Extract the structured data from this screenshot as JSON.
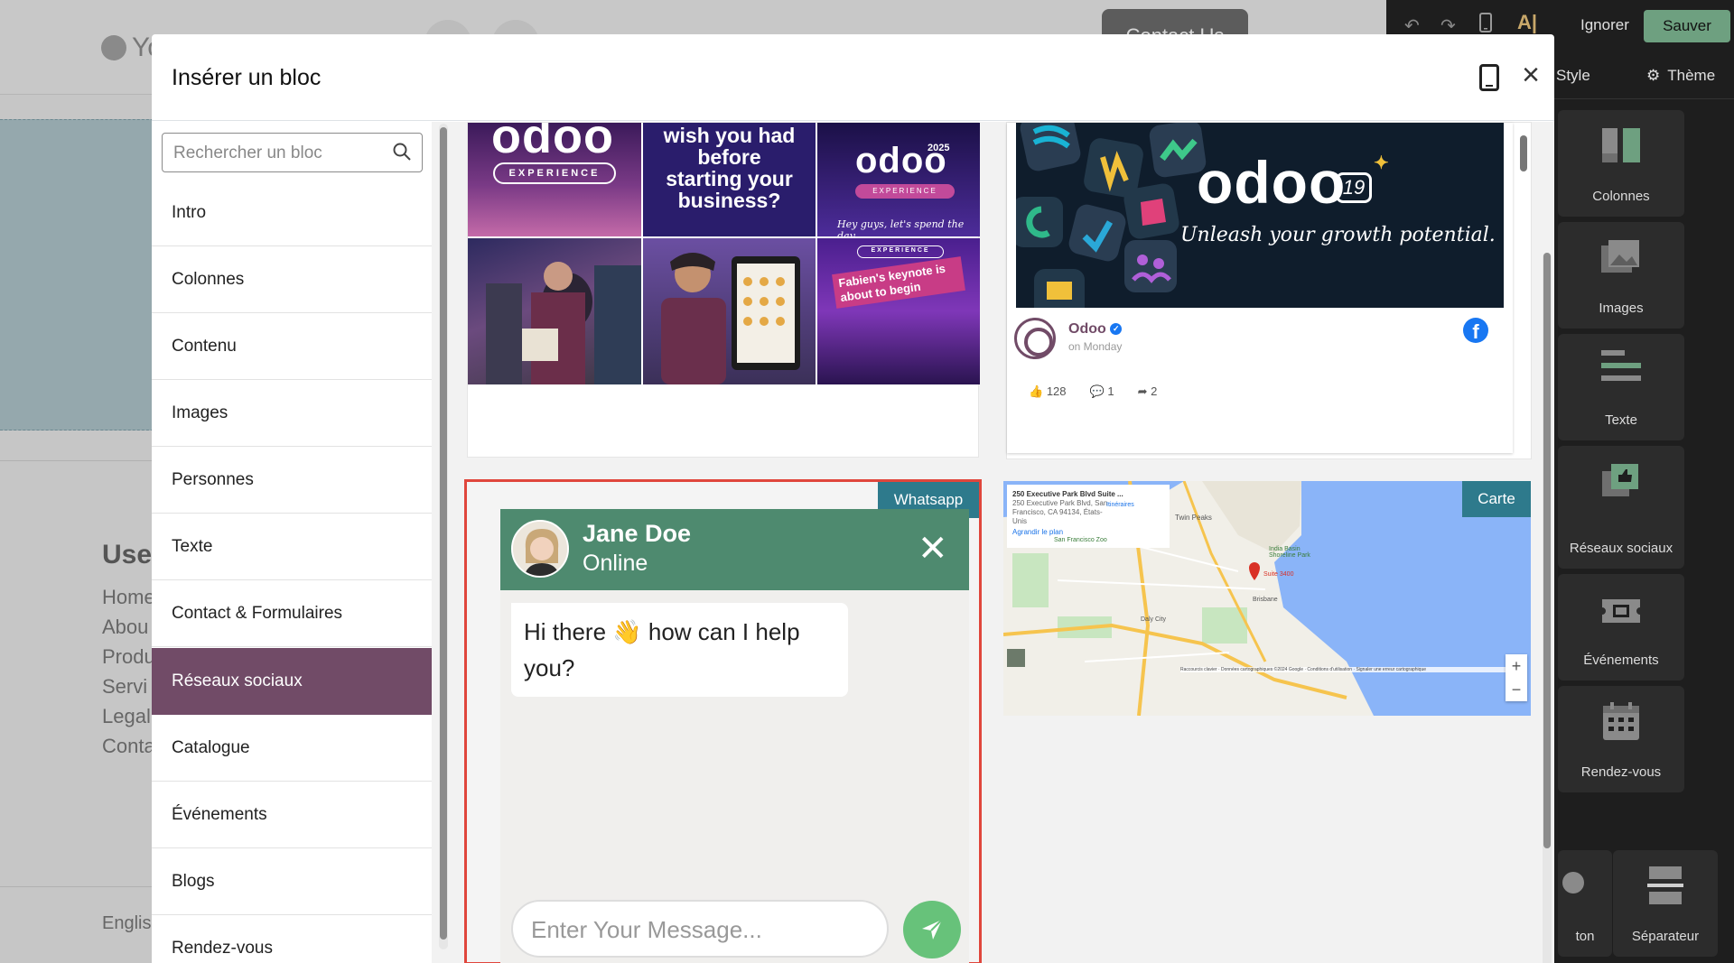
{
  "background": {
    "logo_text": "Yo",
    "contact_button": "Contact Us",
    "useful_heading": "Usef",
    "links": [
      "Home",
      "Abou",
      "Produ",
      "Servi",
      "Legal",
      "Conta"
    ],
    "language": "Englis"
  },
  "editor": {
    "ignore_label": "Ignorer",
    "save_label": "Sauver",
    "tabs": [
      "Style",
      "Thème"
    ],
    "blocks": [
      {
        "label": "Colonnes",
        "icon": "columns-icon"
      },
      {
        "label": "Images",
        "icon": "images-icon"
      },
      {
        "label": "Texte",
        "icon": "text-icon"
      },
      {
        "label": "Réseaux sociaux",
        "icon": "social-icon"
      },
      {
        "label": "Événements",
        "icon": "ticket-icon"
      },
      {
        "label": "Rendez-vous",
        "icon": "calendar-icon"
      },
      {
        "label": "ton",
        "icon": "button-icon"
      },
      {
        "label": "Séparateur",
        "icon": "separator-icon"
      }
    ],
    "colors": {
      "save": "#6ea080",
      "bg": "#1e1e1e"
    }
  },
  "modal": {
    "title": "Insérer un bloc",
    "search_placeholder": "Rechercher un bloc",
    "categories": [
      "Intro",
      "Colonnes",
      "Contenu",
      "Images",
      "Personnes",
      "Texte",
      "Contact & Formulaires",
      "Réseaux sociaux",
      "Catalogue",
      "Événements",
      "Blogs",
      "Rendez-vous"
    ],
    "active_category": "Réseaux sociaux",
    "accent_color": "#714b67"
  },
  "instagram": {
    "tile1_logo": "odoo",
    "tile1_badge": "EXPERIENCE",
    "tile2_text": "wish you had before starting your business?",
    "tile3_year": "2025",
    "tile3_logo": "odoo",
    "tile3_badge": "EXPERIENCE",
    "tile3_caption": "Hey guys, let's spend the day",
    "tile6_badge": "EXPERIENCE",
    "tile6_caption": "Fabien's keynote is about to begin"
  },
  "facebook": {
    "banner_logo": "odoo",
    "banner_version": "19",
    "banner_tagline": "Unleash your growth potential.",
    "page_name": "Odoo",
    "post_time": "on Monday",
    "likes": "128",
    "comments": "1",
    "shares": "2"
  },
  "whatsapp": {
    "badge": "Whatsapp",
    "name": "Jane Doe",
    "status": "Online",
    "message": "Hi there 👋 how can I help you?",
    "input_placeholder": "Enter Your Message...",
    "header_color": "#4e8a6f",
    "send_color": "#67c27a"
  },
  "map": {
    "badge": "Carte",
    "place_name": "250 Executive Park Blvd Suite ...",
    "place_address": "250 Executive Park Blvd, San Francisco, CA 94134, États-Unis",
    "directions": "Itinéraires",
    "enlarge": "Agrandir le plan",
    "labels": [
      "Twin Peaks",
      "San Francisco Zoo",
      "Daly City",
      "Brisbane",
      "Suite 3400",
      "India Basin Shoreline Park"
    ],
    "footer": "Raccourcis clavier · Données cartographiques ©2024 Google · Conditions d'utilisation · Signaler une erreur cartographique"
  }
}
